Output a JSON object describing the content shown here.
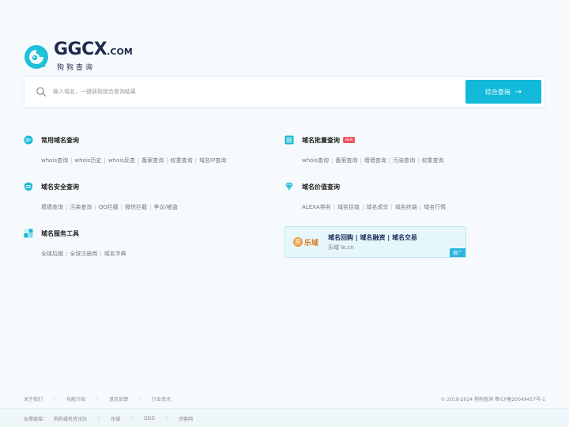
{
  "brand": {
    "name": "GGCX",
    "suffix": ".COM",
    "subtitle": "狗狗查询",
    "accent_color": "#12b9d9",
    "dark_color": "#1f2a4e"
  },
  "search": {
    "placeholder": "输入域名，一键获取综合查询结果",
    "button_label": "综合查询",
    "button_icon": "arrow-right-icon"
  },
  "sections": {
    "common": {
      "title": "常用域名查询",
      "icon": "globe-icon",
      "links": [
        "whois查询",
        "whois历史",
        "whois反查",
        "备案查询",
        "权重查询",
        "域名IP查询"
      ]
    },
    "batch": {
      "title": "域名批量查询",
      "badge": "NEW",
      "icon": "list-icon",
      "links": [
        "whois查询",
        "备案查询",
        "墙墙查询",
        "污染查询",
        "权重查询"
      ]
    },
    "security": {
      "title": "域名安全查询",
      "icon": "shield-icon",
      "links": [
        "墙墙查询",
        "污染查询",
        "QQ拦截",
        "微信拦截",
        "争议/被盗"
      ]
    },
    "value": {
      "title": "域名价值查询",
      "icon": "diamond-icon",
      "links": [
        "ALEXA排名",
        "域名估值",
        "域名成交",
        "域名终端",
        "域名行情"
      ]
    },
    "service": {
      "title": "域名服务工具",
      "icon": "grid-icon",
      "links": [
        "全球后缀",
        "全球注册商",
        "域名字典"
      ]
    }
  },
  "ad": {
    "logo_text": "乐域",
    "logo_char": "乐",
    "title": "域名回购 | 域名融资 | 域名交易",
    "subtitle": "乐域 le.cn",
    "tag": "推广"
  },
  "footer": {
    "links": [
      "关于我们",
      "功能介绍",
      "意见反馈",
      "行业资讯"
    ],
    "copyright": "© 2018-2024 狗狗查询  粤ICP备20049457号-1"
  },
  "friend_links": {
    "label": "友情链接：",
    "links": [
      "狗狗域名资讯站",
      "乐域",
      "DDD",
      "须客网"
    ]
  }
}
